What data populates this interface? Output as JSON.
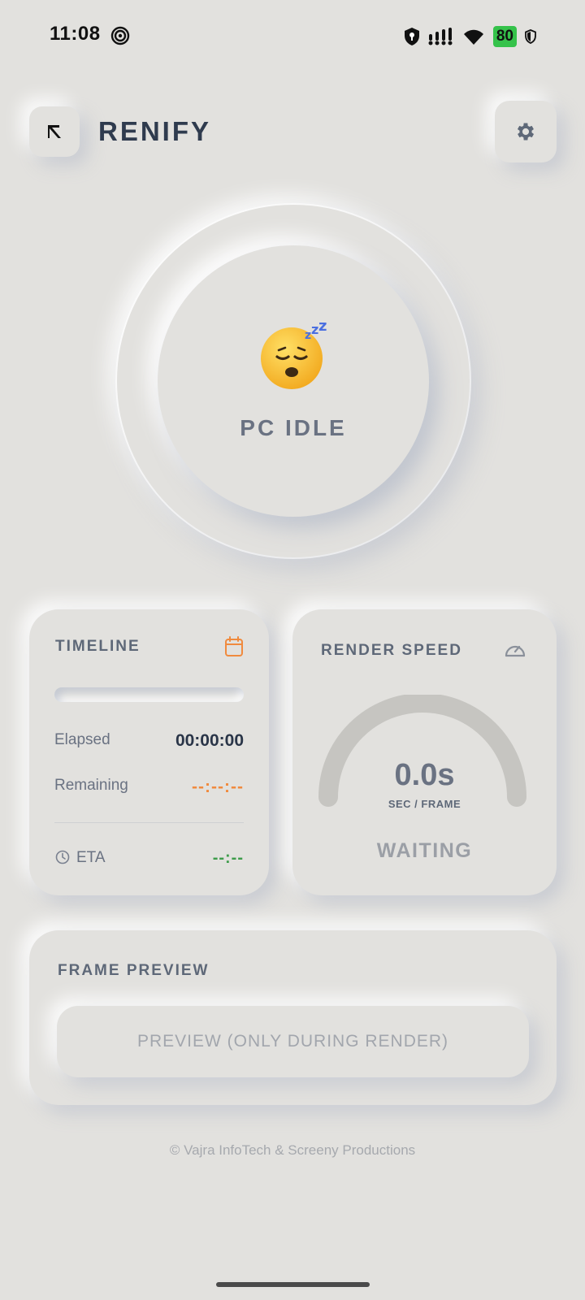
{
  "status_bar": {
    "time": "11:08",
    "battery": "80",
    "icons": [
      "spiral-icon",
      "shield-icon",
      "signal-icon",
      "wifi-icon",
      "battery-icon",
      "vpn-shield-icon"
    ]
  },
  "header": {
    "app_title": "RENIFY",
    "logo_icon": "renify-logo-icon",
    "settings_icon": "gear-icon"
  },
  "status": {
    "emoji": "😴",
    "label": "PC IDLE"
  },
  "timeline": {
    "title": "TIMELINE",
    "progress_fraction": 0,
    "elapsed_label": "Elapsed",
    "elapsed_value": "00:00:00",
    "remaining_label": "Remaining",
    "remaining_value": "--:--:--",
    "eta_label": "ETA",
    "eta_value": "--:--"
  },
  "render_speed": {
    "title": "RENDER SPEED",
    "value": "0.0s",
    "unit": "SEC / FRAME",
    "state": "WAITING",
    "gauge_fraction": 0
  },
  "frame_preview": {
    "title": "FRAME PREVIEW",
    "button_label": "PREVIEW (ONLY DURING RENDER)"
  },
  "footer": "© Vajra InfoTech & Screeny Productions",
  "colors": {
    "background": "#e2e1de",
    "accent_orange": "#f08a3e",
    "eta_green": "#3d9c4a",
    "battery_green": "#35c24a"
  }
}
